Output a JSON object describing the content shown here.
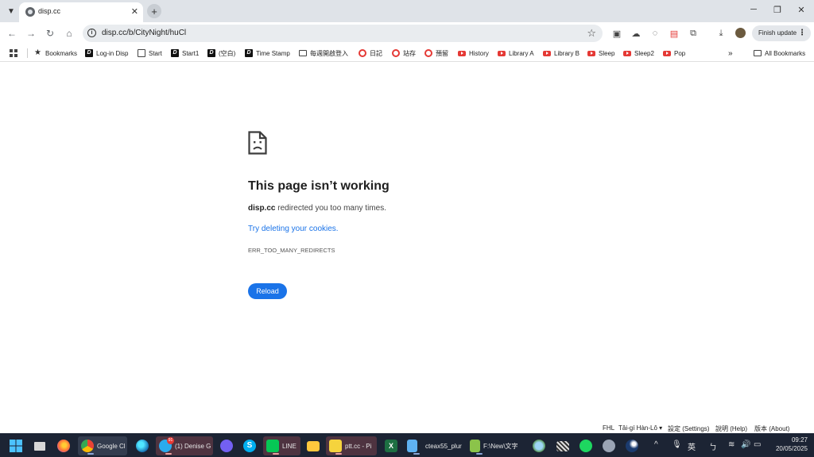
{
  "browser": {
    "tab": {
      "title": "disp.cc"
    },
    "omnibox": {
      "url": "disp.cc/b/CityNight/huCl"
    },
    "finish_update_label": "Finish update",
    "bookmarks": [
      {
        "label": "Bookmarks",
        "icon": "star-icon"
      },
      {
        "label": "Log-in Disp",
        "icon": "calendar-icon"
      },
      {
        "label": "Start",
        "icon": "calendar-icon"
      },
      {
        "label": "Start1",
        "icon": "disp-icon"
      },
      {
        "label": "(空白)",
        "icon": "disp-icon"
      },
      {
        "label": "Time Stamp",
        "icon": "disp-icon"
      },
      {
        "label": "每週開啟登入",
        "icon": "folder-icon"
      },
      {
        "label": "日記",
        "icon": "red-circle-icon"
      },
      {
        "label": "站存",
        "icon": "red-circle-icon"
      },
      {
        "label": "預留",
        "icon": "red-circle-icon"
      },
      {
        "label": "History",
        "icon": "youtube-icon"
      },
      {
        "label": "Library A",
        "icon": "youtube-icon"
      },
      {
        "label": "Library B",
        "icon": "youtube-icon"
      },
      {
        "label": "Sleep",
        "icon": "youtube-icon"
      },
      {
        "label": "Sleep2",
        "icon": "youtube-icon"
      },
      {
        "label": "Pop",
        "icon": "youtube-icon"
      }
    ],
    "more_bookmarks": "»",
    "all_bookmarks_label": "All Bookmarks"
  },
  "error_page": {
    "title": "This page isn’t working",
    "host": "disp.cc",
    "message": " redirected you too many times.",
    "link_text": "Try deleting your cookies",
    "link_suffix": ".",
    "error_code": "ERR_TOO_MANY_REDIRECTS",
    "reload_label": "Reload"
  },
  "ime_bar": {
    "mode": "FHL",
    "language": "Tâi-gí Hàn-Lô ▾",
    "settings": "設定 (Settings)",
    "help": "說明 (Help)",
    "about": "版本 (About)"
  },
  "taskbar": {
    "apps": [
      {
        "label": "Google Cl"
      },
      {
        "label": "(1) Denise G",
        "badge": "91"
      },
      {
        "label": "LINE"
      },
      {
        "label": "ptt.cc - Pi"
      },
      {
        "label": "cteax55_plur"
      },
      {
        "label": "F:\\New\\文字"
      }
    ],
    "ime_char": "英",
    "time": "09:27",
    "date": "20/05/2025"
  },
  "colors": {
    "accent": "#1a73e8",
    "titlebar": "#dfe3e8",
    "taskbar": "#1c2434"
  }
}
